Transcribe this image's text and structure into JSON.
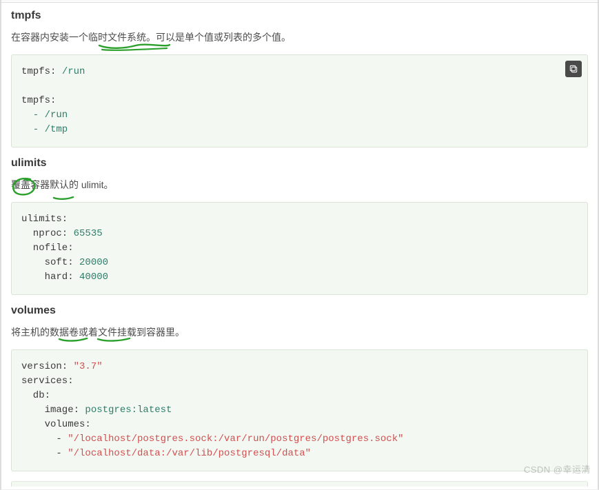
{
  "watermark": "CSDN @幸运清",
  "sections": {
    "tmpfs": {
      "title": "tmpfs",
      "desc": "在容器内安装一个临时文件系统。可以是单个值或列表的多个值。",
      "code": {
        "line1_key": "tmpfs:",
        "line1_val": " /run",
        "line2_key": "tmpfs:",
        "line3": "  - /run",
        "line4": "  - /tmp"
      }
    },
    "ulimits": {
      "title": "ulimits",
      "desc": "覆盖容器默认的 ulimit。",
      "code": {
        "l1": "ulimits:",
        "l2k": "  nproc:",
        "l2v": " 65535",
        "l3": "  nofile:",
        "l4k": "    soft:",
        "l4v": " 20000",
        "l5k": "    hard:",
        "l5v": " 40000"
      }
    },
    "volumes": {
      "title": "volumes",
      "desc": "将主机的数据卷或着文件挂载到容器里。",
      "code": {
        "l1k": "version:",
        "l1v": " \"3.7\"",
        "l2": "services:",
        "l3": "  db:",
        "l4k": "    image:",
        "l4v": " postgres:latest",
        "l5": "    volumes:",
        "l6p": "      - ",
        "l6s": "\"/localhost/postgres.sock:/var/run/postgres/postgres.sock\"",
        "l7p": "      - ",
        "l7s": "\"/localhost/data:/var/lib/postgresql/data\""
      }
    }
  }
}
